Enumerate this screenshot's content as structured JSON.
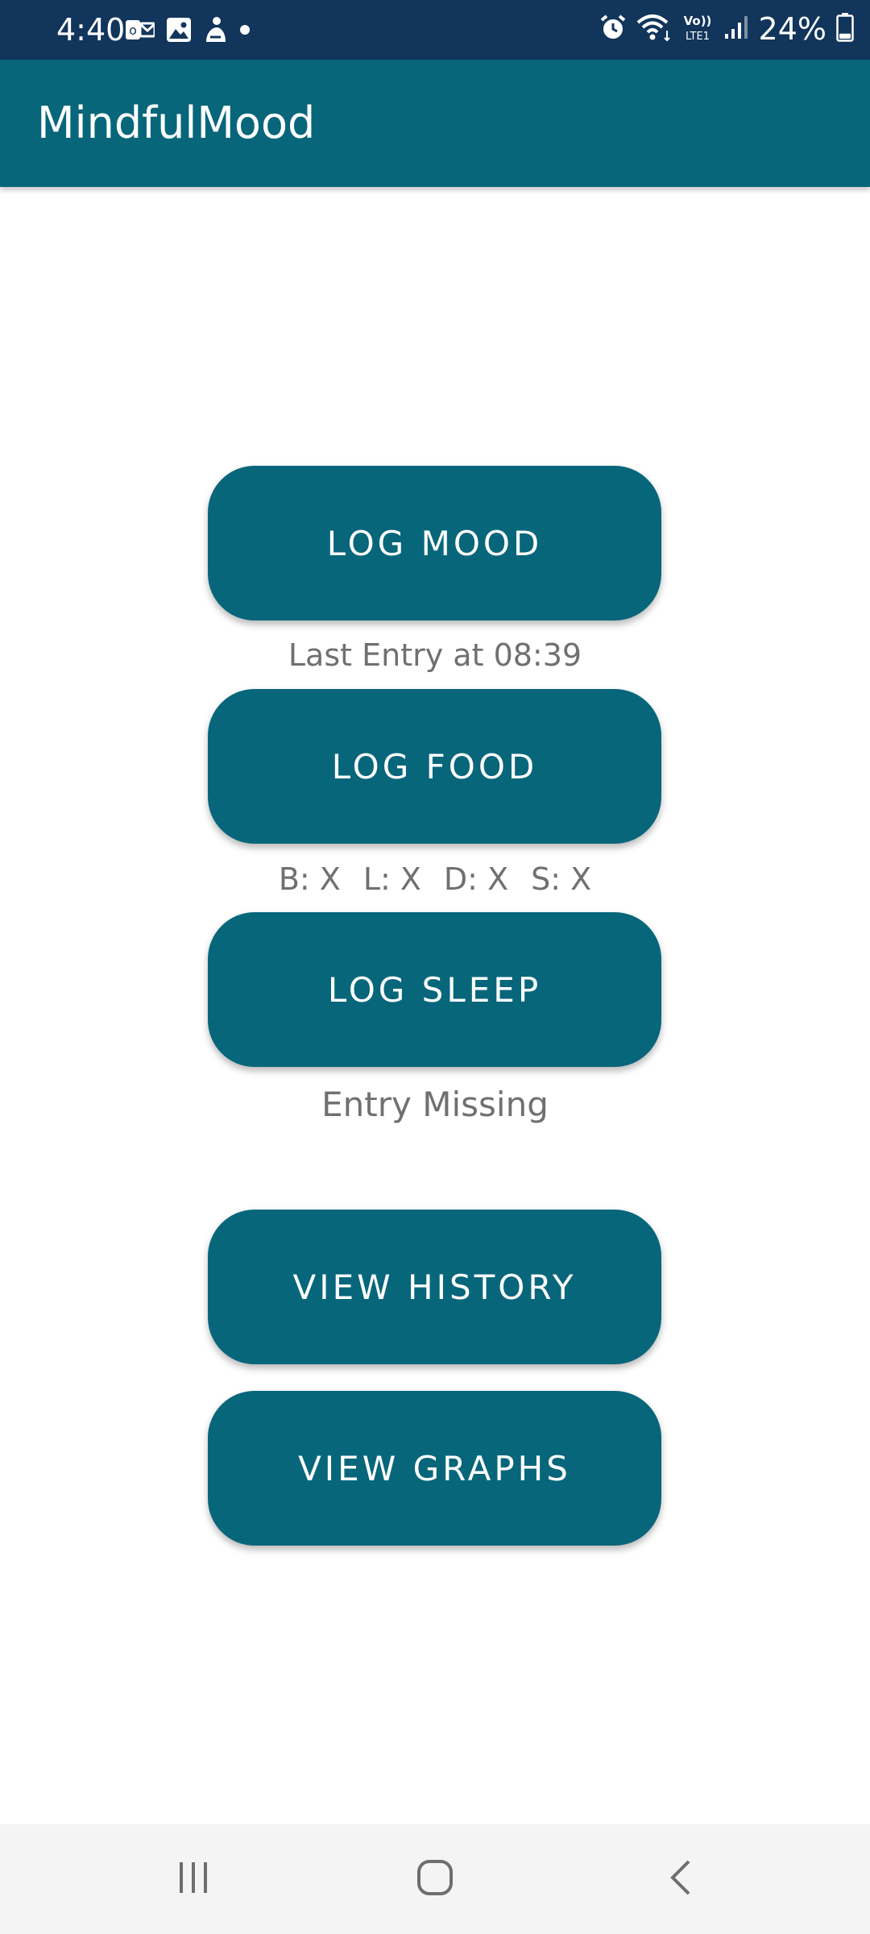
{
  "status_bar": {
    "time": "4:40",
    "left_icons": [
      "outlook-notification-icon",
      "gallery-notification-icon",
      "app-notification-icon",
      "more-notifications-dot-icon"
    ],
    "right_icons": [
      "alarm-icon",
      "wifi-icon",
      "volte-lte1-icon",
      "signal-icon"
    ],
    "volte_top": "Vo))",
    "volte_bottom": "LTE1",
    "battery_percent": "24%",
    "battery_level": 0.24
  },
  "app_bar": {
    "title": "MindfulMood"
  },
  "main": {
    "log_mood_label": "LOG MOOD",
    "mood_status": "Last Entry at 08:39",
    "log_food_label": "LOG FOOD",
    "food_status": [
      "B: X",
      "L: X",
      "D: X",
      "S: X"
    ],
    "log_sleep_label": "LOG SLEEP",
    "sleep_status": "Entry Missing",
    "view_history_label": "VIEW HISTORY",
    "view_graphs_label": "VIEW GRAPHS"
  },
  "nav_bar": {
    "buttons": [
      "recent-apps-icon",
      "home-icon",
      "back-icon"
    ]
  },
  "colors": {
    "status_bar": "#11355b",
    "primary": "#08667b",
    "secondary_text": "#707070",
    "nav_background": "#f4f4f4"
  }
}
